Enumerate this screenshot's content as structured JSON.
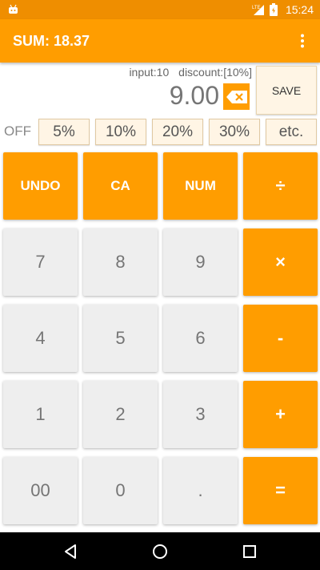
{
  "status_bar": {
    "time": "15:24",
    "network": "LTE",
    "icons": [
      "android-icon",
      "signal-icon",
      "battery-icon"
    ]
  },
  "app_bar": {
    "title": "SUM: 18.37",
    "menu_icon": "more-vert-icon"
  },
  "display": {
    "input_label": "input:10",
    "discount_label": "discount:[10%]",
    "value": "9.00",
    "save_label": "SAVE"
  },
  "discount": {
    "off_label": "OFF",
    "options": [
      "5%",
      "10%",
      "20%",
      "30%",
      "etc."
    ]
  },
  "keypad": {
    "row1": [
      "UNDO",
      "CA",
      "NUM",
      "÷"
    ],
    "row2": [
      "7",
      "8",
      "9",
      "×"
    ],
    "row3": [
      "4",
      "5",
      "6",
      "-"
    ],
    "row4": [
      "1",
      "2",
      "3",
      "+"
    ],
    "row5": [
      "00",
      "0",
      ".",
      "="
    ]
  },
  "colors": {
    "accent": "#ff9d00",
    "status_bar": "#ef8e00",
    "key_grey": "#eeeeee",
    "button_light": "#fff5e5"
  }
}
